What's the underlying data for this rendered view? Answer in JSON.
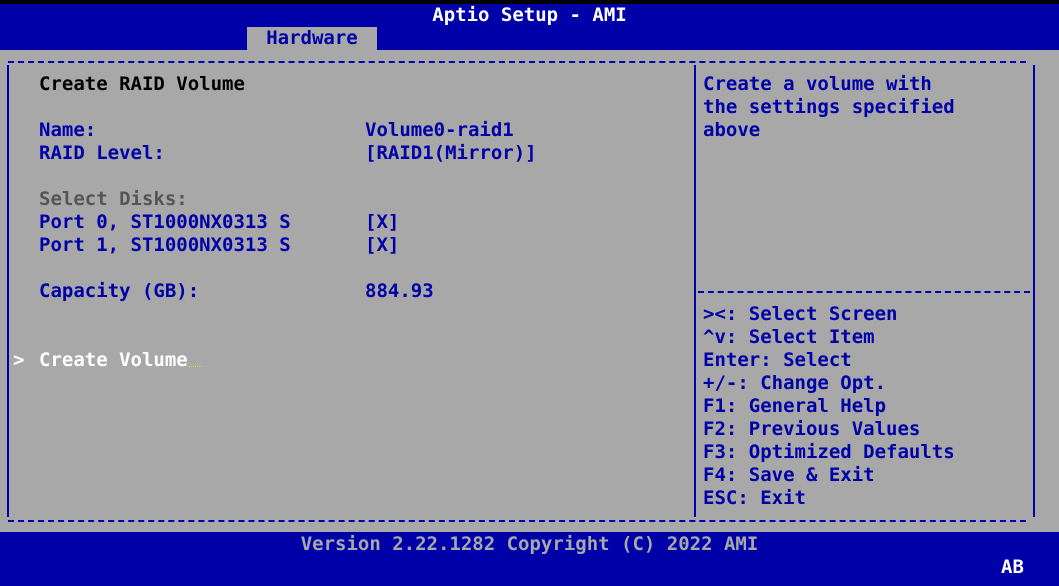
{
  "app_title": "Aptio Setup - AMI",
  "active_tab": "Hardware",
  "form": {
    "heading": "Create RAID Volume",
    "name_label": "Name:",
    "name_value": "Volume0-raid1",
    "raid_level_label": "RAID Level:",
    "raid_level_value": "[RAID1(Mirror)]",
    "select_disks_label": "Select Disks:",
    "disks": [
      {
        "label": "Port 0, ST1000NX0313 S",
        "value": "[X]"
      },
      {
        "label": "Port 1, ST1000NX0313 S",
        "value": "[X]"
      }
    ],
    "capacity_label": "Capacity (GB):",
    "capacity_value": "884.93",
    "selection_marker": ">",
    "create_volume_label": "Create Volume"
  },
  "help_text": [
    "Create a volume with",
    "the settings specified",
    "above"
  ],
  "key_help": [
    "><: Select Screen",
    "^v: Select Item",
    "Enter: Select",
    "+/-: Change Opt.",
    "F1: General Help",
    "F2: Previous Values",
    "F3: Optimized Defaults",
    "F4: Save & Exit",
    "ESC: Exit"
  ],
  "footer": "Version 2.22.1282 Copyright (C) 2022 AMI",
  "badge": "AB",
  "colors": {
    "background": "#0000a8",
    "panel": "#a8a8a8",
    "text_blue": "#0000a8",
    "highlight": "#ffffff"
  }
}
